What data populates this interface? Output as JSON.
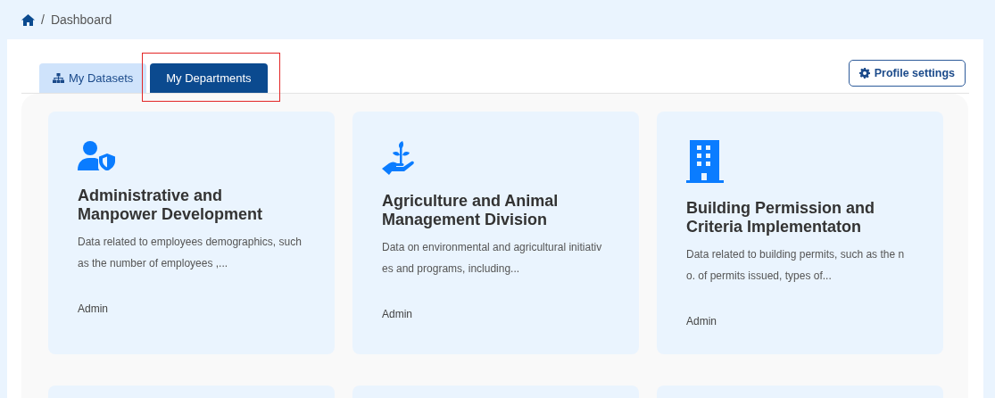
{
  "breadcrumb": {
    "separator": "/",
    "current": "Dashboard"
  },
  "tabs": [
    {
      "label": "My Datasets",
      "selected": false,
      "highlighted": false
    },
    {
      "label": "My Departments",
      "selected": true,
      "highlighted": true
    }
  ],
  "profile_button": {
    "label": "Profile settings"
  },
  "cards": [
    {
      "kind": "full",
      "title": "Administrative and Manpower Development",
      "description": "Data related to employees demographics, such as the number of employees ,...",
      "owner": "Admin"
    },
    {
      "kind": "full",
      "title": "Agriculture and Animal Management Division",
      "description": "Data on environmental and agricultural initiativ es and programs, including...",
      "owner": "Admin"
    },
    {
      "kind": "full",
      "title": "Building Permission and Criteria Implementaton",
      "description": "Data related to building permits, such as the n o. of permits issued, types of...",
      "owner": "Admin"
    },
    {
      "kind": "stub"
    },
    {
      "kind": "stub"
    },
    {
      "kind": "stub"
    }
  ]
}
